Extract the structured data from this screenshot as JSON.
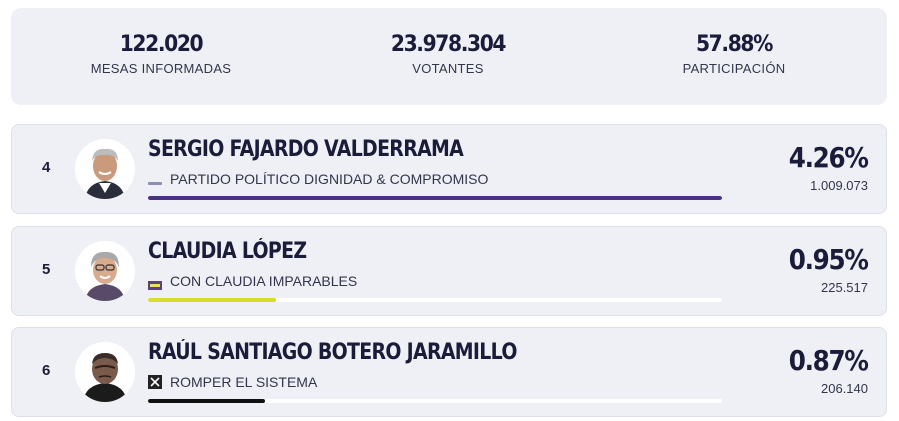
{
  "summary": {
    "mesas": {
      "value": "122.020",
      "label": "MESAS INFORMADAS"
    },
    "votantes": {
      "value": "23.978.304",
      "label": "VOTANTES"
    },
    "participacion": {
      "value": "57.88%",
      "label": "PARTICIPACIÓN"
    }
  },
  "candidates": [
    {
      "rank": "4",
      "name": "SERGIO FAJARDO VALDERRAMA",
      "party": "PARTIDO POLÍTICO DIGNIDAD & COMPROMISO",
      "party_logo_icon": "dignidad-compromiso-logo-icon",
      "percent": "4.26%",
      "votes": "1.009.073",
      "bar_fraction": 1.0,
      "bar_color": "#4a3184"
    },
    {
      "rank": "5",
      "name": "CLAUDIA LÓPEZ",
      "party": "CON CLAUDIA IMPARABLES",
      "party_logo_icon": "imparables-logo-icon",
      "percent": "0.95%",
      "votes": "225.517",
      "bar_fraction": 0.223,
      "bar_color": "#d8dc2a"
    },
    {
      "rank": "6",
      "name": "RAÚL SANTIAGO BOTERO JARAMILLO",
      "party": "ROMPER EL SISTEMA",
      "party_logo_icon": "romper-sistema-logo-icon",
      "percent": "0.87%",
      "votes": "206.140",
      "bar_fraction": 0.204,
      "bar_color": "#111111"
    }
  ]
}
